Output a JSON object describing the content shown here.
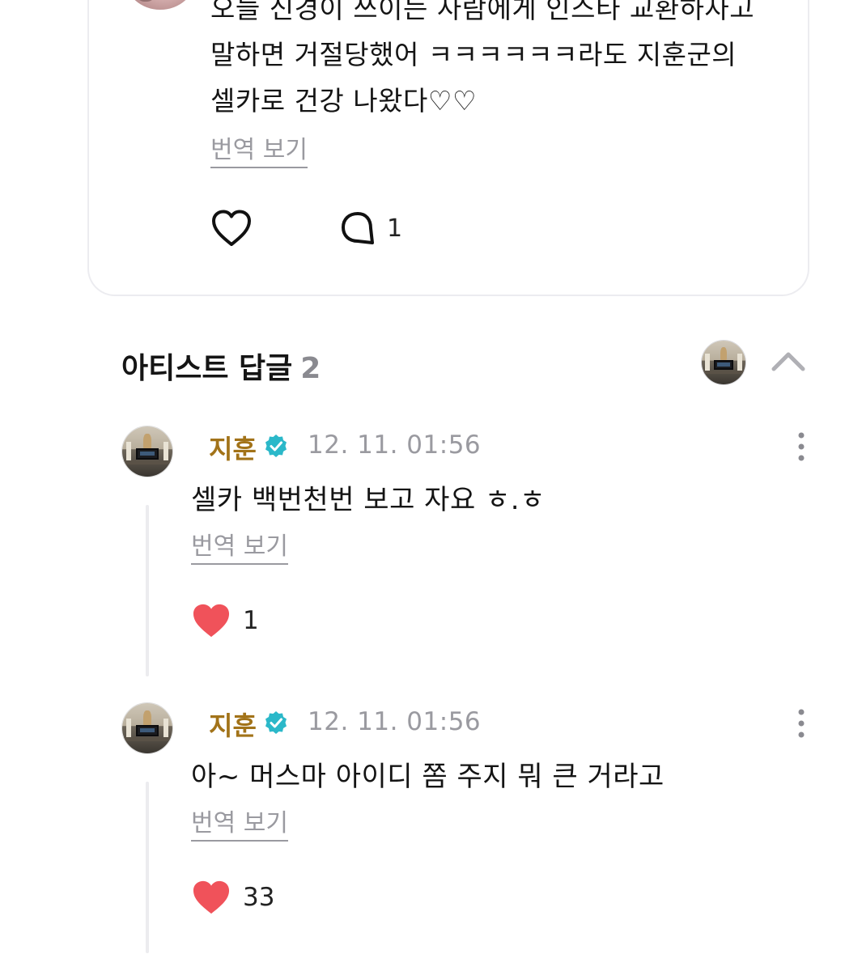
{
  "post": {
    "text": "오늘 신경이 쓰이는 사람에게 인스타 교환하자고\n말하면 거절당했어 ㅋㅋㅋㅋㅋㅋ라도 지훈군의\n셀카로 건강 나왔다♡♡",
    "translate_label": "번역 보기",
    "comment_count": "1",
    "avatar_icon": "user-avatar",
    "like_icon": "heart-outline-icon",
    "comment_icon": "speech-bubble-icon"
  },
  "artist_replies": {
    "title": "아티스트 답글",
    "count": "2",
    "collapse_icon": "chevron-up-icon",
    "replies": [
      {
        "name": "지훈",
        "time": "12. 11. 01:56",
        "text": "셀카 백번천번 보고 자요 ㅎ.ㅎ",
        "translate_label": "번역 보기",
        "like_count": "1"
      },
      {
        "name": "지훈",
        "time": "12. 11. 01:56",
        "text": "아~ 머스마 아이디 쫌 주지 뭐 큰 거라고",
        "translate_label": "번역 보기",
        "like_count": "33"
      }
    ]
  },
  "colors": {
    "artist_name": "#a27319",
    "verified_badge": "#2bb8c9",
    "heart_filled": "#f0525a",
    "muted_text": "#9a9aa0",
    "card_border": "#ececf0"
  }
}
